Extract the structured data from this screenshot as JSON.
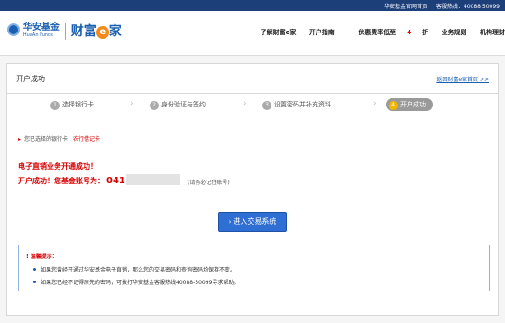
{
  "topbar": {
    "home_link": "华安基金官网首页",
    "hotline_label": "客服热线：40088 50099"
  },
  "header": {
    "logo_cn": "华安基金",
    "logo_en": "HuaAn Funds",
    "brand_prefix": "财富",
    "brand_e": "e",
    "brand_suffix": "家",
    "nav": [
      {
        "label": "了解财富e家"
      },
      {
        "label": "开户指南"
      },
      {
        "label_before": "优惠费率低至",
        "label_red": "4",
        "label_after": "折"
      },
      {
        "label": "业务规则"
      },
      {
        "label": "机构理财"
      }
    ]
  },
  "panel": {
    "title": "开户成功",
    "back_link": "返回财富e家首页 >>",
    "steps": [
      {
        "num": "1",
        "label": "选择银行卡"
      },
      {
        "num": "2",
        "label": "身份验证与签约"
      },
      {
        "num": "3",
        "label": "设置密码并补充资料"
      },
      {
        "num": "4",
        "label": "开户成功"
      }
    ],
    "bank_label": "您已选择的银行卡：",
    "bank_value": "农行借记卡",
    "success_line1": "电子直销业务开通成功！",
    "success_line2": "开户成功！您基金账号为：",
    "account_prefix": "041",
    "remember_note": "(请务必记住账号)",
    "enter_button": "进入交易系统",
    "tips_title": "温馨提示：",
    "tips": [
      "如果您曾经开通过华安基金电子直销，那么您的交易密码和查询密码均保持不变。",
      "如果您已经不记得原先的密码，可拨打华安基金客服热线40088-50099寻求帮助。"
    ]
  }
}
